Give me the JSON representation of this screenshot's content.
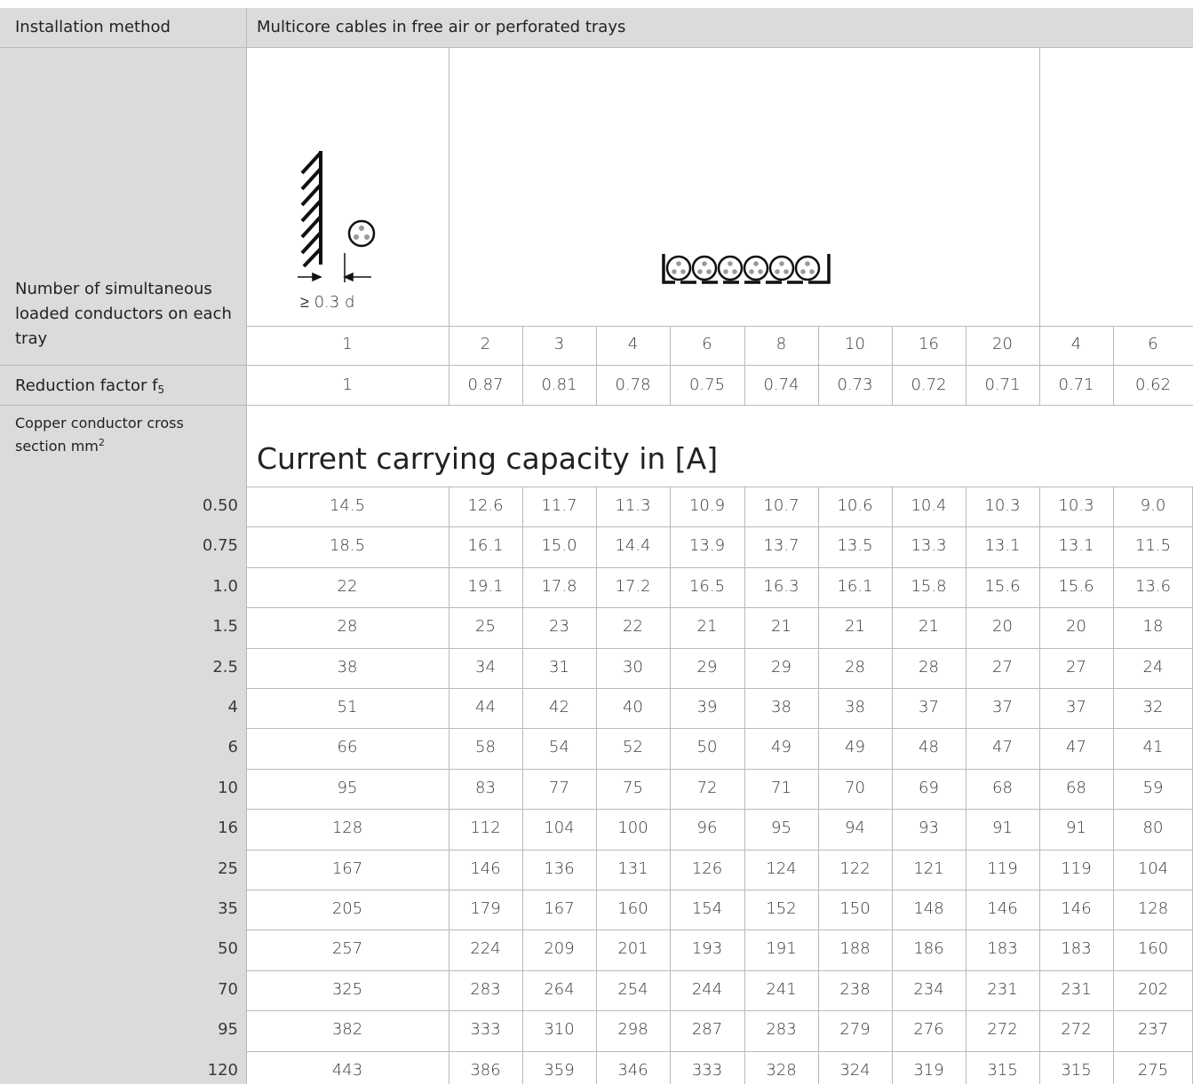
{
  "header": {
    "installation_method_label": "Installation method",
    "installation_method_value": "Multicore cables in free air or perforated trays"
  },
  "figures": {
    "spacing_label": "≥ 0.3 d"
  },
  "labels": {
    "number_conductors": "Number of simultaneous loaded conductors on each tray",
    "reduction_factor": "Reduction factor f",
    "reduction_factor_sub": "5",
    "copper_cross_section": "Copper conductor cross section mm",
    "copper_cross_section_sup": "2",
    "capacity_title": "Current carrying capacity in [A]"
  },
  "table": {
    "conductor_counts": [
      "1",
      "2",
      "3",
      "4",
      "6",
      "8",
      "10",
      "16",
      "20",
      "4",
      "6"
    ],
    "reduction_factors": [
      "1",
      "0.87",
      "0.81",
      "0.78",
      "0.75",
      "0.74",
      "0.73",
      "0.72",
      "0.71",
      "0.71",
      "0.62"
    ],
    "rows": [
      {
        "section": "0.50",
        "values": [
          "14.5",
          "12.6",
          "11.7",
          "11.3",
          "10.9",
          "10.7",
          "10.6",
          "10.4",
          "10.3",
          "10.3",
          "9.0"
        ]
      },
      {
        "section": "0.75",
        "values": [
          "18.5",
          "16.1",
          "15.0",
          "14.4",
          "13.9",
          "13.7",
          "13.5",
          "13.3",
          "13.1",
          "13.1",
          "11.5"
        ]
      },
      {
        "section": "1.0",
        "values": [
          "22",
          "19.1",
          "17.8",
          "17.2",
          "16.5",
          "16.3",
          "16.1",
          "15.8",
          "15.6",
          "15.6",
          "13.6"
        ]
      },
      {
        "section": "1.5",
        "values": [
          "28",
          "25",
          "23",
          "22",
          "21",
          "21",
          "21",
          "21",
          "20",
          "20",
          "18"
        ]
      },
      {
        "section": "2.5",
        "values": [
          "38",
          "34",
          "31",
          "30",
          "29",
          "29",
          "28",
          "28",
          "27",
          "27",
          "24"
        ]
      },
      {
        "section": "4",
        "values": [
          "51",
          "44",
          "42",
          "40",
          "39",
          "38",
          "38",
          "37",
          "37",
          "37",
          "32"
        ]
      },
      {
        "section": "6",
        "values": [
          "66",
          "58",
          "54",
          "52",
          "50",
          "49",
          "49",
          "48",
          "47",
          "47",
          "41"
        ]
      },
      {
        "section": "10",
        "values": [
          "95",
          "83",
          "77",
          "75",
          "72",
          "71",
          "70",
          "69",
          "68",
          "68",
          "59"
        ]
      },
      {
        "section": "16",
        "values": [
          "128",
          "112",
          "104",
          "100",
          "96",
          "95",
          "94",
          "93",
          "91",
          "91",
          "80"
        ]
      },
      {
        "section": "25",
        "values": [
          "167",
          "146",
          "136",
          "131",
          "126",
          "124",
          "122",
          "121",
          "119",
          "119",
          "104"
        ]
      },
      {
        "section": "35",
        "values": [
          "205",
          "179",
          "167",
          "160",
          "154",
          "152",
          "150",
          "148",
          "146",
          "146",
          "128"
        ]
      },
      {
        "section": "50",
        "values": [
          "257",
          "224",
          "209",
          "201",
          "193",
          "191",
          "188",
          "186",
          "183",
          "183",
          "160"
        ]
      },
      {
        "section": "70",
        "values": [
          "325",
          "283",
          "264",
          "254",
          "244",
          "241",
          "238",
          "234",
          "231",
          "231",
          "202"
        ]
      },
      {
        "section": "95",
        "values": [
          "382",
          "333",
          "310",
          "298",
          "287",
          "283",
          "279",
          "276",
          "272",
          "272",
          "237"
        ]
      },
      {
        "section": "120",
        "values": [
          "443",
          "386",
          "359",
          "346",
          "333",
          "328",
          "324",
          "319",
          "315",
          "315",
          "275"
        ]
      }
    ]
  }
}
